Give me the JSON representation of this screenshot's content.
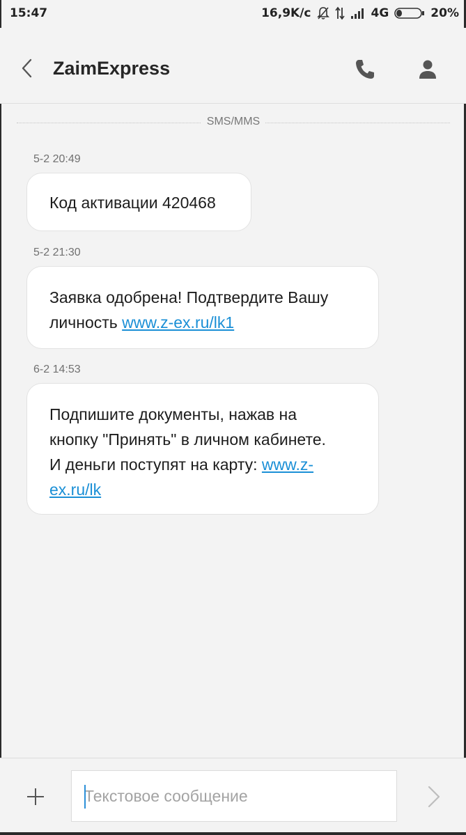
{
  "status_bar": {
    "time": "15:47",
    "network_speed": "16,9K/c",
    "network_type": "4G",
    "battery": "20%",
    "icons": [
      "mute-bell-icon",
      "data-transfer-icon",
      "signal-icon",
      "battery-icon"
    ]
  },
  "header": {
    "contact_name": "ZaimExpress",
    "icons": [
      "back-arrow-icon",
      "phone-icon",
      "person-icon"
    ]
  },
  "thread": {
    "divider_label": "SMS/MMS",
    "messages": [
      {
        "timestamp": "5-2 20:49",
        "text": "Код активации 420468",
        "link": ""
      },
      {
        "timestamp": "5-2 21:30",
        "text": "Заявка одобрена! Подтвердите Вашу личность ",
        "link": "www.z-ex.ru/lk1"
      },
      {
        "timestamp": "6-2 14:53",
        "text_lines": [
          "Подпишите документы, нажав на",
          "кнопку \"Принять\" в личном кабинете.",
          "И деньги поступят на карту: "
        ],
        "link_part1": "www.z-",
        "link_part2": "ex.ru/lk"
      }
    ]
  },
  "composer": {
    "placeholder": "Текстовое сообщение",
    "icons": [
      "plus-icon",
      "send-icon"
    ]
  },
  "colors": {
    "background": "#f3f3f3",
    "bubble": "#ffffff",
    "link": "#1a8fd6",
    "cursor": "#2a8fd8"
  }
}
